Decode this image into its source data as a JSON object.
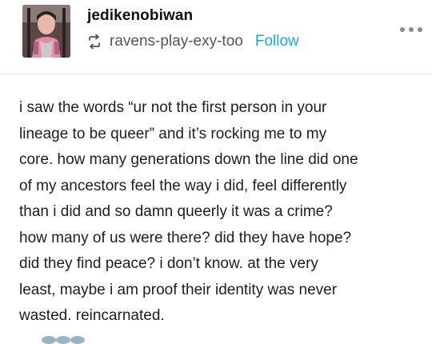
{
  "post": {
    "username": "jedikenobiwan",
    "reblog": {
      "icon": "reblog-icon",
      "source": "ravens-play-exy-too",
      "follow_label": "Follow"
    },
    "more_icon": "more-dots-icon",
    "body_lines": [
      "i saw the words “ur not the first person in your",
      "lineage to be queer” and it’s rocking me to my",
      "core. how many generations down the line did one",
      "of my ancestors feel the way i did, feel differently",
      "than i did and so damn queerly it was a crime?",
      "how many of us were there? did they have hope?",
      "did they find peace? i don’t know. at the very",
      "least, maybe i am proof their identity was never",
      "wasted. reincarnated."
    ]
  },
  "colors": {
    "follow": "#19a8d8",
    "text": "#1e1e1e",
    "muted": "#555555"
  }
}
